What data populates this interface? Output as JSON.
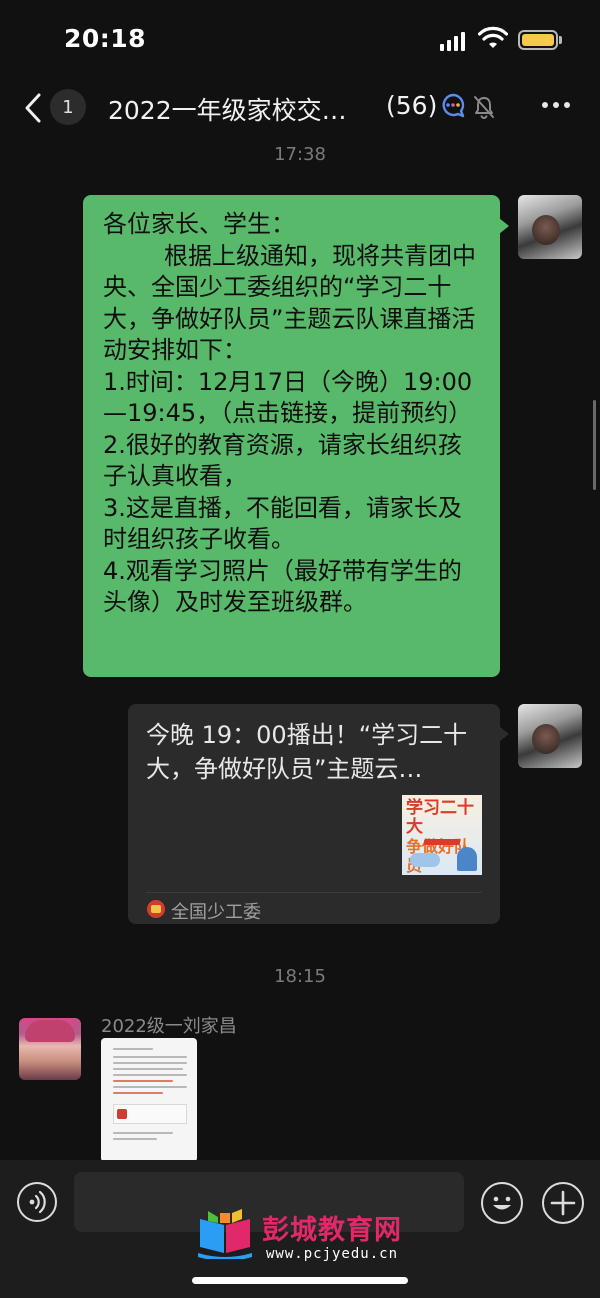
{
  "status_bar": {
    "time": "20:18"
  },
  "header": {
    "unread_count": "1",
    "title": "2022一年级家校交流群",
    "member_count": "(56)"
  },
  "messages": [
    {
      "type": "timestamp",
      "text": "17:38"
    },
    {
      "type": "text",
      "direction": "outgoing",
      "text": "各位家长、学生：\n        根据上级通知，现将共青团中央、全国少工委组织的“学习二十大，争做好队员”主题云队课直播活动安排如下：\n1.时间：12月17日（今晚）19:00—19:45，（点击链接，提前预约）\n2.很好的教育资源，请家长组织孩子认真收看，\n3.这是直播，不能回看，请家长及时组织孩子收看。\n4.观看学习照片（最好带有学生的头像）及时发至班级群。"
    },
    {
      "type": "link_card",
      "direction": "outgoing",
      "title": "今晚 19：00播出！“学习二十大，争做好队员”主题云…",
      "thumbnail_text_1": "学习二十大",
      "thumbnail_text_2": "争做好队员",
      "source": "全国少工委"
    },
    {
      "type": "timestamp",
      "text": "18:15"
    },
    {
      "type": "image",
      "direction": "incoming",
      "sender": "2022级一刘家昌"
    }
  ],
  "watermark": {
    "name": "彭城教育网",
    "url": "www.pcjyedu.cn"
  },
  "colors": {
    "background": "#111111",
    "outgoing_bubble": "#58b96b",
    "link_card": "#2b2b2b",
    "battery": "#f5c94a",
    "watermark": "#e0286a"
  },
  "icons": [
    "back-icon",
    "group-icon",
    "mute-icon",
    "more-icon",
    "voice-icon",
    "emoji-icon",
    "plus-icon"
  ]
}
